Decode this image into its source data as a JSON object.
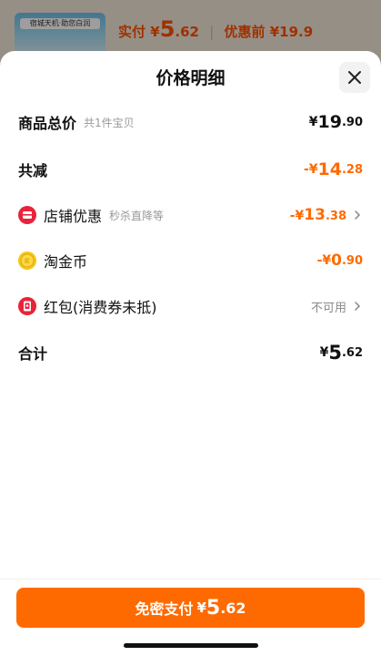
{
  "background": {
    "thumb_text": "宿城天机·助您白润",
    "pay_label": "实付",
    "pay_currency": "¥",
    "pay_int": "5",
    "pay_dec": ".62",
    "before_label": "优惠前",
    "before_price": "¥19.9"
  },
  "sheet": {
    "title": "价格明细"
  },
  "rows": {
    "total": {
      "label": "商品总价",
      "sub": "共1件宝贝",
      "currency": "¥",
      "int": "19",
      "dec": ".90"
    },
    "reduce": {
      "label": "共减",
      "currency": "-¥",
      "int": "14",
      "dec": ".28"
    },
    "shop": {
      "label": "店铺优惠",
      "sub": "秒杀直降等",
      "currency": "-¥",
      "int": "13",
      "dec": ".38"
    },
    "coin": {
      "label": "淘金币",
      "currency": "-¥",
      "int": "0",
      "dec": ".90"
    },
    "redpacket": {
      "label": "红包(消费券未抵)",
      "status": "不可用"
    },
    "sum": {
      "label": "合计",
      "currency": "¥",
      "int": "5",
      "dec": ".62"
    }
  },
  "footer": {
    "button_text": "免密支付",
    "currency": "¥",
    "int": "5",
    "dec": ".62"
  },
  "colors": {
    "accent": "#ff6a00",
    "red_icon": "#e8233a",
    "coin_icon": "#f5c518"
  }
}
